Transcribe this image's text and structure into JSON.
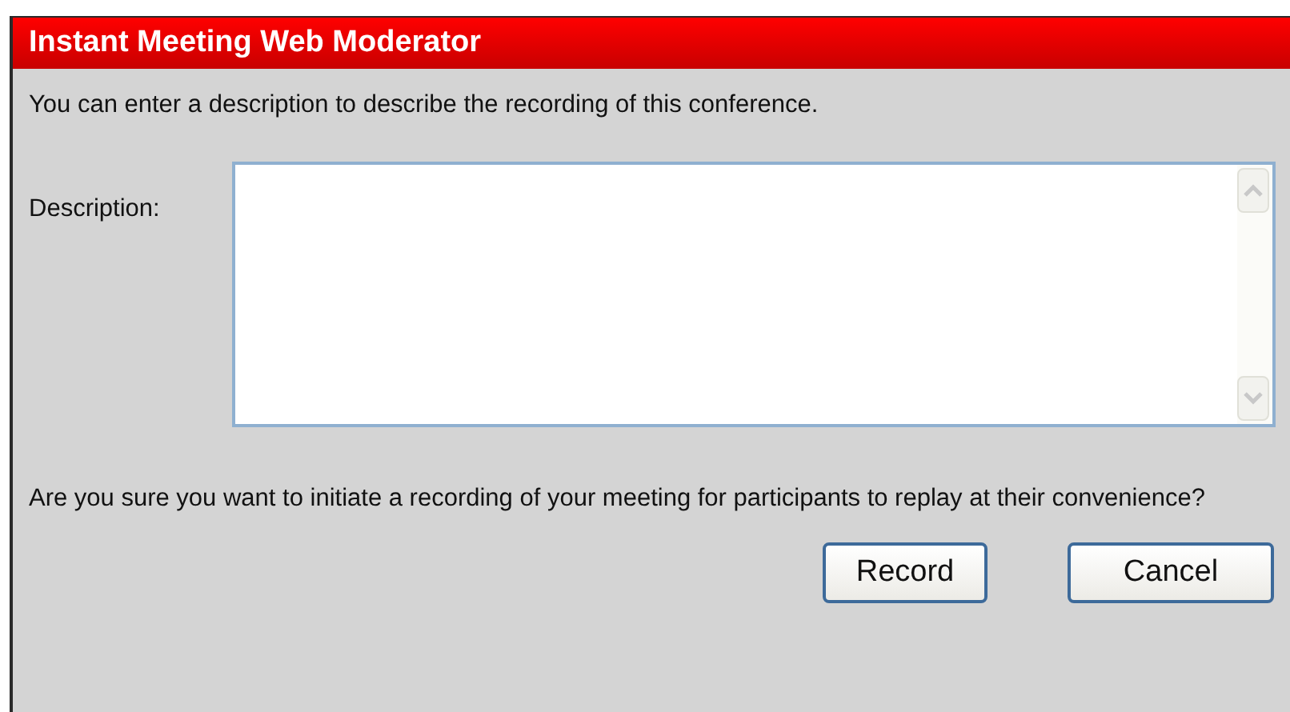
{
  "window": {
    "title": "Instant Meeting Web Moderator"
  },
  "intro": "You can enter a description to describe the recording of this conference.",
  "description": {
    "label": "Description:"
  },
  "question": "Are you sure you want to initiate a recording of your meeting for participants to replay at their convenience?",
  "buttons": [
    "Record",
    "Cancel"
  ]
}
